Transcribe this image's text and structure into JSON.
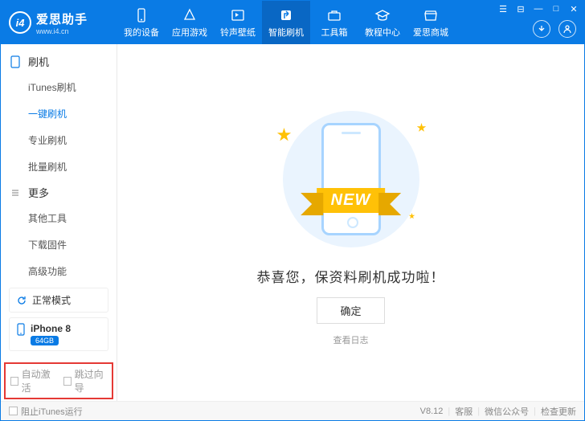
{
  "logo": {
    "badge": "i4",
    "title": "爱思助手",
    "url": "www.i4.cn"
  },
  "tabs": [
    {
      "label": "我的设备"
    },
    {
      "label": "应用游戏"
    },
    {
      "label": "铃声壁纸"
    },
    {
      "label": "智能刷机"
    },
    {
      "label": "工具箱"
    },
    {
      "label": "教程中心"
    },
    {
      "label": "爱思商城"
    }
  ],
  "sidebar": {
    "group1": {
      "title": "刷机",
      "items": [
        "iTunes刷机",
        "一键刷机",
        "专业刷机",
        "批量刷机"
      ],
      "active": 1
    },
    "group2": {
      "title": "更多",
      "items": [
        "其他工具",
        "下载固件",
        "高级功能"
      ]
    }
  },
  "status": {
    "mode": "正常模式",
    "device": "iPhone 8",
    "storage": "64GB"
  },
  "checks": {
    "auto_activate": "自动激活",
    "skip_guide": "跳过向导",
    "block_itunes": "阻止iTunes运行"
  },
  "content": {
    "ribbon": "NEW",
    "message": "恭喜您，保资料刷机成功啦！",
    "ok": "确定",
    "log": "查看日志"
  },
  "footer": {
    "version": "V8.12",
    "support": "客服",
    "wechat": "微信公众号",
    "update": "检查更新"
  }
}
